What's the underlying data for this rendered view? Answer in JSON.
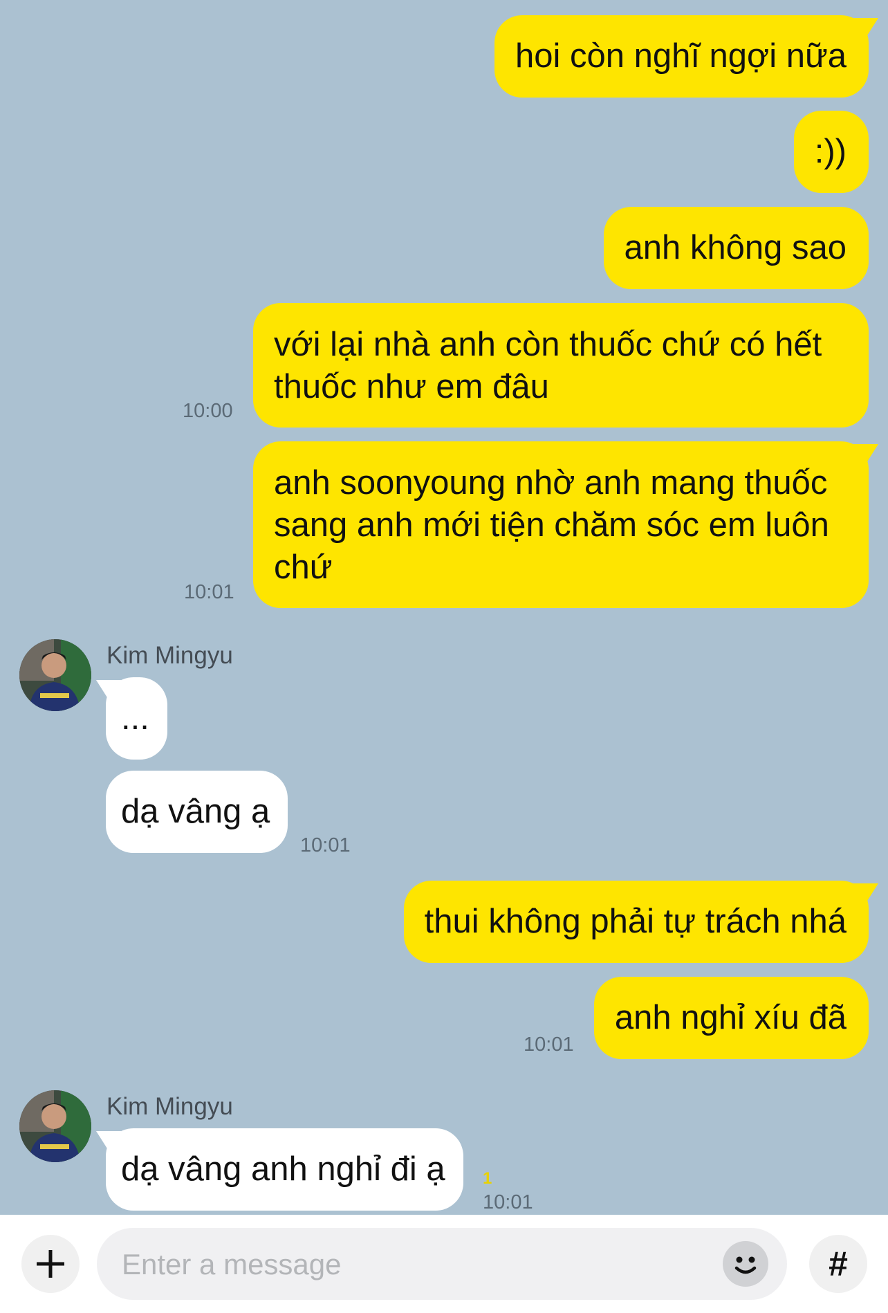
{
  "messages": [
    {
      "text": "hoi còn nghĩ ngợi nữa"
    },
    {
      "text": ":))"
    },
    {
      "text": "anh không sao"
    },
    {
      "text": "với lại nhà anh còn thuốc chứ có hết thuốc như em đâu",
      "time": "10:00"
    },
    {
      "text": "anh soonyoung nhờ anh mang thuốc sang anh mới tiện chăm sóc em luôn chứ",
      "time": "10:01"
    },
    {
      "sender": "Kim Mingyu",
      "text": "..."
    },
    {
      "text": "dạ vâng ạ",
      "time": "10:01"
    },
    {
      "text": "thui không phải tự trách nhá"
    },
    {
      "text": "anh nghỉ xíu đã",
      "time": "10:01"
    },
    {
      "sender": "Kim Mingyu",
      "text": "dạ vâng anh nghỉ đi ạ",
      "unread": "1",
      "time": "10:01"
    }
  ],
  "composer": {
    "add_icon": "plus-icon",
    "placeholder": "Enter a message",
    "emoji_icon": "smiley-icon",
    "hash_label": "#"
  },
  "colors": {
    "background": "#abc1d1",
    "outgoing": "#fee500",
    "incoming": "#ffffff"
  }
}
